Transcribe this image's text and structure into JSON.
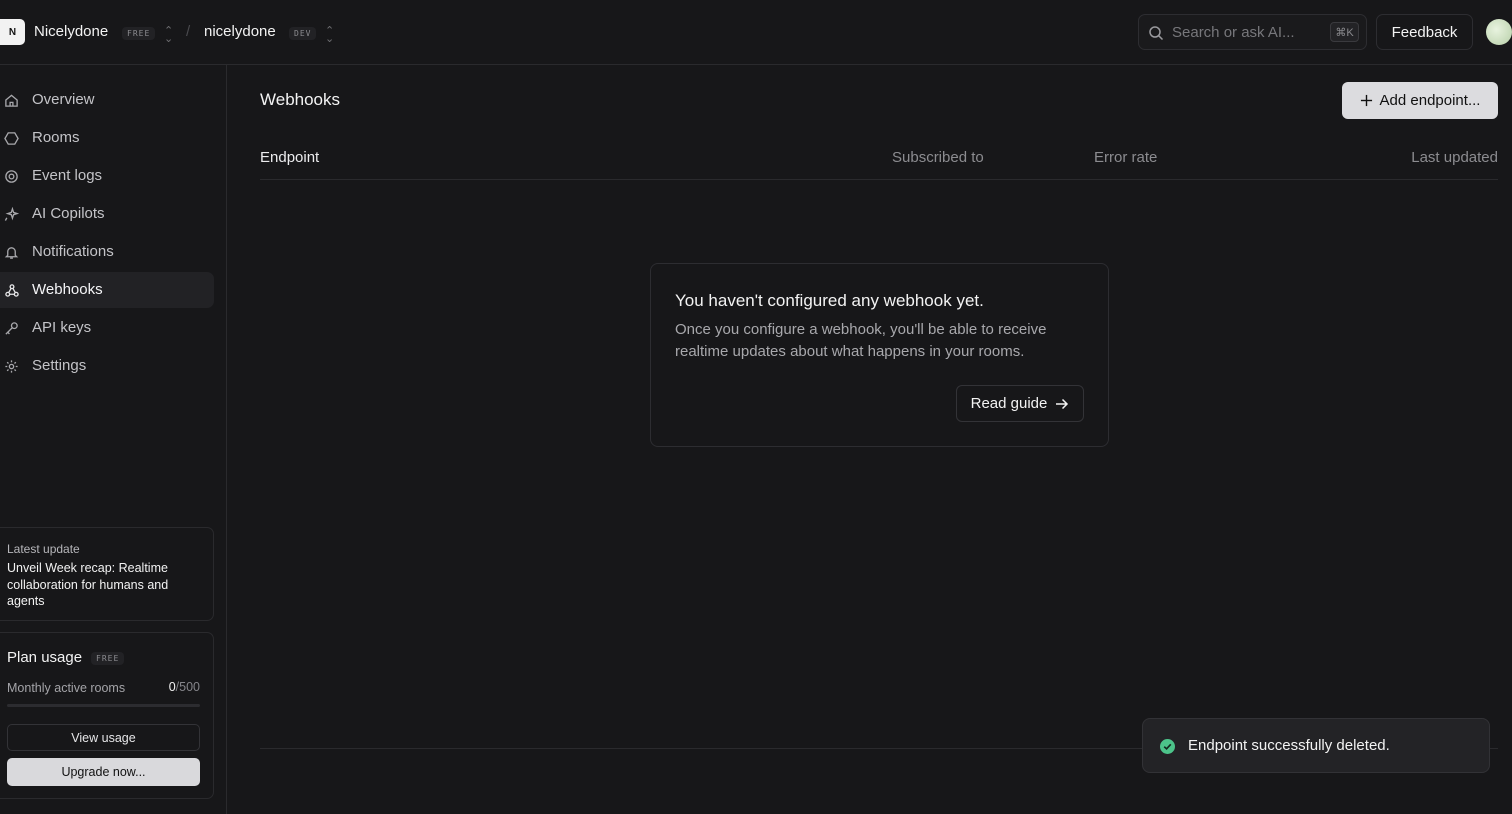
{
  "topbar": {
    "org_initial": "N",
    "org_name": "Nicelydone",
    "org_plan_badge": "FREE",
    "separator": "/",
    "project_name": "nicelydone",
    "project_env_badge": "DEV",
    "search_placeholder": "Search or ask AI...",
    "search_shortcut": "⌘K",
    "feedback_label": "Feedback"
  },
  "sidebar": {
    "items": [
      {
        "label": "Overview",
        "icon": "home-icon"
      },
      {
        "label": "Rooms",
        "icon": "hexagon-icon"
      },
      {
        "label": "Event logs",
        "icon": "target-icon"
      },
      {
        "label": "AI Copilots",
        "icon": "sparkle-icon"
      },
      {
        "label": "Notifications",
        "icon": "bell-icon"
      },
      {
        "label": "Webhooks",
        "icon": "webhook-icon",
        "active": true
      },
      {
        "label": "API keys",
        "icon": "key-icon"
      },
      {
        "label": "Settings",
        "icon": "gear-icon"
      }
    ],
    "update": {
      "kicker": "Latest update",
      "headline": "Unveil Week recap: Realtime collaboration for humans and agents"
    },
    "plan": {
      "title": "Plan usage",
      "badge": "FREE",
      "metric_label": "Monthly active rooms",
      "current": "0",
      "limit": "/500",
      "progress_percent": 0,
      "view_usage_label": "View usage",
      "upgrade_label": "Upgrade now..."
    }
  },
  "main": {
    "title": "Webhooks",
    "add_endpoint_label": "Add endpoint...",
    "columns": [
      "Endpoint",
      "Subscribed to",
      "Error rate",
      "Last updated"
    ],
    "empty_state": {
      "title": "You haven't configured any webhook yet.",
      "description": "Once you configure a webhook, you'll be able to receive realtime updates about what happens in your rooms.",
      "button_label": "Read guide"
    }
  },
  "toast": {
    "message": "Endpoint successfully deleted.",
    "status_color": "#4cc38a"
  }
}
